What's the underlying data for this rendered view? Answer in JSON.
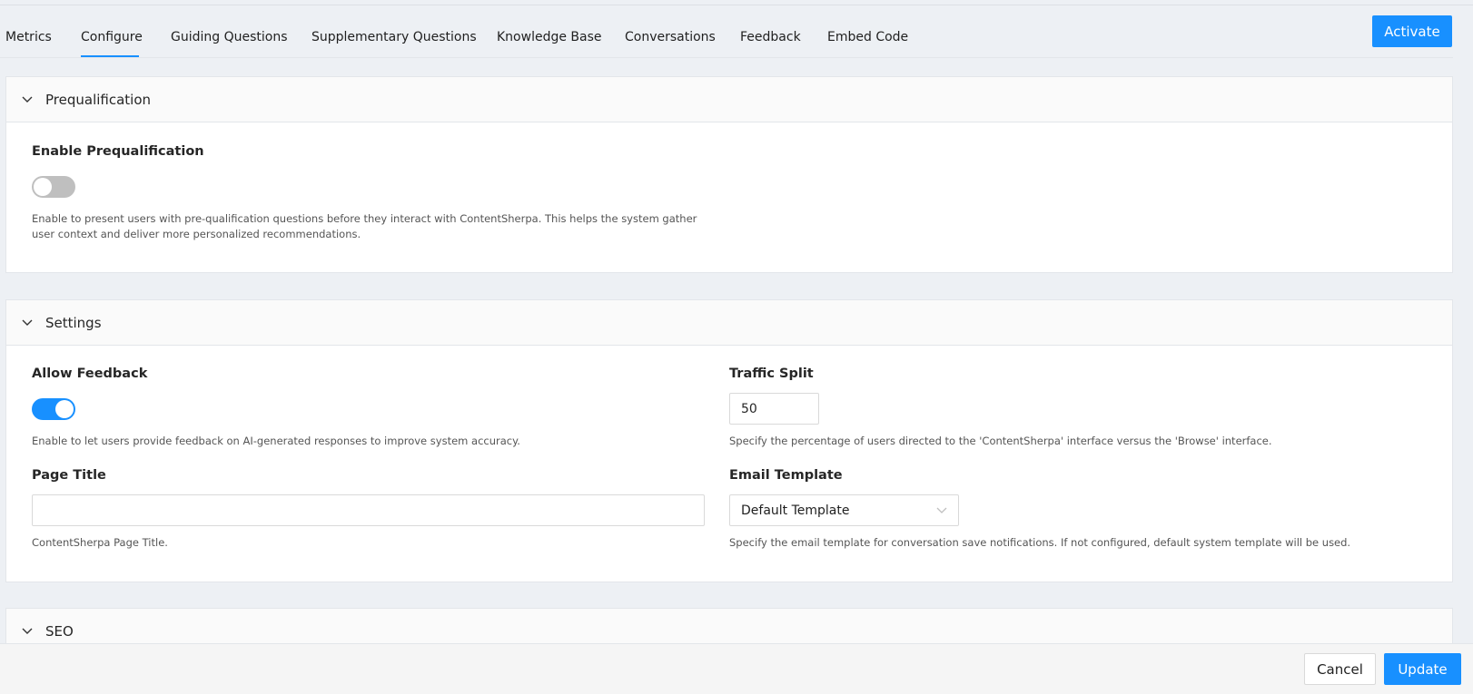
{
  "tabs": [
    {
      "label": "Metrics"
    },
    {
      "label": "Configure"
    },
    {
      "label": "Guiding Questions"
    },
    {
      "label": "Supplementary Questions"
    },
    {
      "label": "Knowledge Base"
    },
    {
      "label": "Conversations"
    },
    {
      "label": "Feedback"
    },
    {
      "label": "Embed Code"
    }
  ],
  "active_tab": "Configure",
  "header": {
    "activate_label": "Activate"
  },
  "prequalification": {
    "title": "Prequalification",
    "enable_label": "Enable Prequalification",
    "enabled": false,
    "help_line1": "Enable to present users with pre-qualification questions before they interact with ContentSherpa. This helps the system gather",
    "help_line2": "user context and deliver more personalized recommendations."
  },
  "settings": {
    "title": "Settings",
    "allow_feedback": {
      "label": "Allow Feedback",
      "enabled": true,
      "help": "Enable to let users provide feedback on AI-generated responses to improve system accuracy."
    },
    "traffic_split": {
      "label": "Traffic Split",
      "value": "50",
      "help": "Specify the percentage of users directed to the 'ContentSherpa' interface versus the 'Browse' interface."
    },
    "page_title": {
      "label": "Page Title",
      "value": "",
      "help": "ContentSherpa Page Title."
    },
    "email_template": {
      "label": "Email Template",
      "selected": "Default Template",
      "help": "Specify the email template for conversation save notifications. If not configured, default system template will be used."
    }
  },
  "seo": {
    "title": "SEO"
  },
  "footer": {
    "cancel_label": "Cancel",
    "update_label": "Update"
  },
  "colors": {
    "accent": "#1890ff",
    "background": "#edf0f4",
    "toggle_off": "#bfbfbf"
  }
}
